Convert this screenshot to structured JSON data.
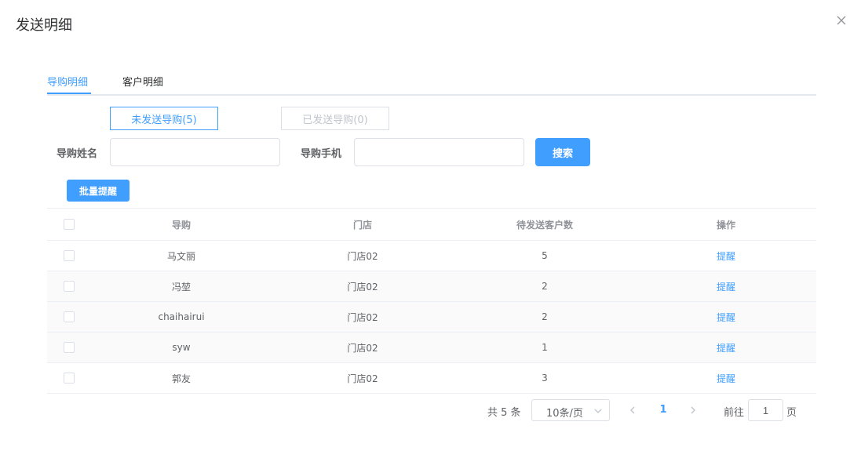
{
  "dialog": {
    "title": "发送明细"
  },
  "tabs": [
    {
      "label": "导购明细",
      "active": true
    },
    {
      "label": "客户明细",
      "active": false
    }
  ],
  "toggles": {
    "unsent": "未发送导购(5)",
    "sent": "已发送导购(0)"
  },
  "filters": {
    "name_label": "导购姓名",
    "name_value": "",
    "phone_label": "导购手机",
    "phone_value": "",
    "search_label": "搜索"
  },
  "batch_remind_label": "批量提醒",
  "table": {
    "columns": [
      "导购",
      "门店",
      "待发送客户数",
      "操作"
    ],
    "rows": [
      {
        "guide": "马文丽",
        "store": "门店02",
        "count": "5",
        "action": "提醒"
      },
      {
        "guide": "冯堃",
        "store": "门店02",
        "count": "2",
        "action": "提醒"
      },
      {
        "guide": "chaihairui",
        "store": "门店02",
        "count": "2",
        "action": "提醒"
      },
      {
        "guide": "syw",
        "store": "门店02",
        "count": "1",
        "action": "提醒"
      },
      {
        "guide": "郭友",
        "store": "门店02",
        "count": "3",
        "action": "提醒"
      }
    ]
  },
  "pagination": {
    "total": "共 5 条",
    "page_size": "10条/页",
    "current_page": "1",
    "goto_label": "前往",
    "goto_value": "1",
    "page_suffix": "页"
  },
  "colors": {
    "accent": "#409eff",
    "border": "#dcdfe6",
    "stripe": "#fafafa"
  }
}
